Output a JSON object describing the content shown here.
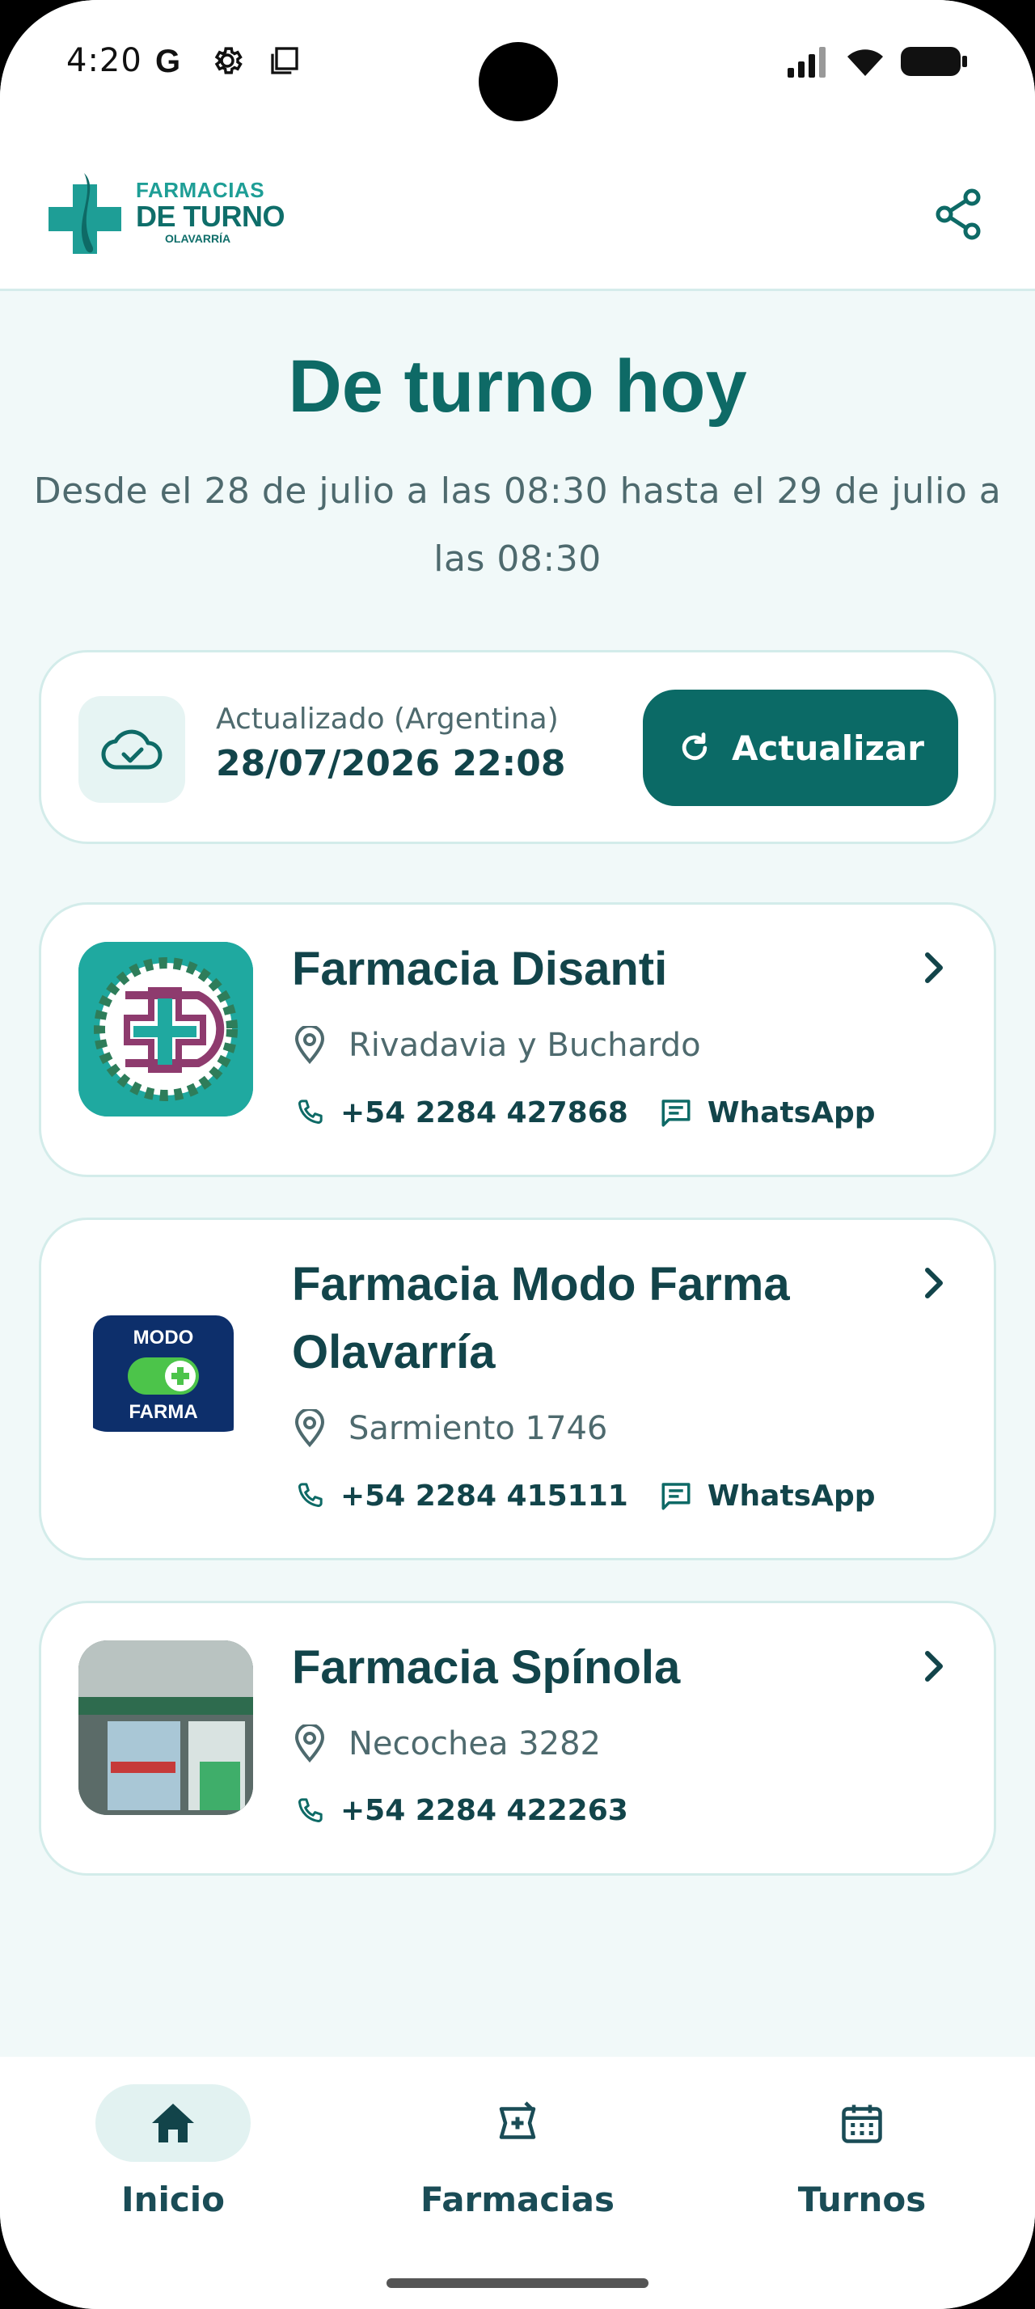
{
  "status_bar": {
    "time": "4:20",
    "left_icons": [
      "google-icon",
      "settings-icon",
      "screenshot-icon"
    ],
    "right_icons": [
      "signal-icon",
      "wifi-icon",
      "battery-icon"
    ]
  },
  "header": {
    "logo": {
      "line1": "FARMACIAS",
      "line2": "DE TURNO",
      "line3": "OLAVARRÍA"
    },
    "share_icon": "share-icon"
  },
  "hero": {
    "title": "De turno hoy",
    "subtitle": "Desde el 28 de julio a las 08:30 hasta el 29 de julio a las 08:30"
  },
  "update": {
    "label": "Actualizado (Argentina)",
    "datetime": "28/07/2026 22:08",
    "button_label": "Actualizar"
  },
  "pharmacies": [
    {
      "name": "Farmacia Disanti",
      "address": "Rivadavia y Buchardo",
      "phone": "+54 2284 427868",
      "whatsapp": "WhatsApp"
    },
    {
      "name": "Farmacia Modo Farma Olavarría",
      "address": "Sarmiento 1746",
      "phone": "+54 2284 415111",
      "whatsapp": "WhatsApp",
      "logo": {
        "line1": "MODO",
        "line2": "FARMA"
      }
    },
    {
      "name": "Farmacia Spínola",
      "address": "Necochea 3282",
      "phone": "+54 2284 422263"
    }
  ],
  "nav": {
    "items": [
      {
        "label": "Inicio",
        "icon": "home-icon",
        "active": true
      },
      {
        "label": "Farmacias",
        "icon": "pharmacy-icon",
        "active": false
      },
      {
        "label": "Turnos",
        "icon": "calendar-icon",
        "active": false
      }
    ]
  },
  "colors": {
    "primary": "#0B6A66",
    "text_dark": "#12444A",
    "text_muted": "#4E6A6E",
    "background": "#F1F9F9",
    "card_border": "#D3ECEA"
  }
}
